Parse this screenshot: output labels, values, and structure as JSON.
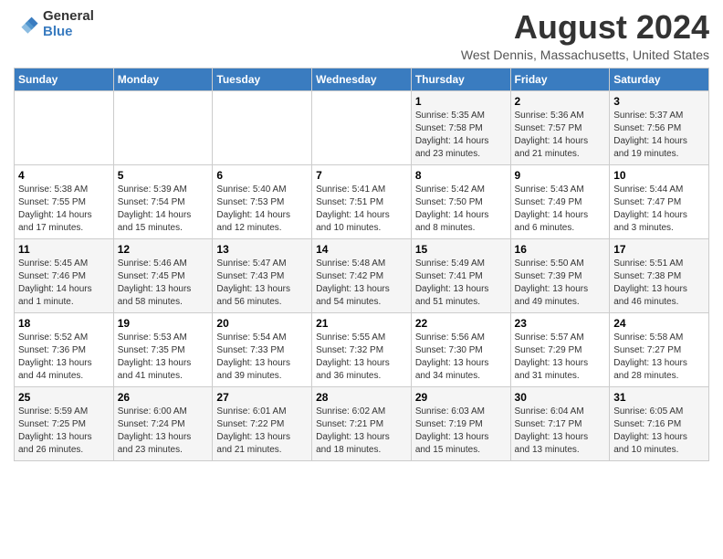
{
  "logo": {
    "general": "General",
    "blue": "Blue"
  },
  "title": "August 2024",
  "subtitle": "West Dennis, Massachusetts, United States",
  "days_of_week": [
    "Sunday",
    "Monday",
    "Tuesday",
    "Wednesday",
    "Thursday",
    "Friday",
    "Saturday"
  ],
  "weeks": [
    [
      {
        "day": "",
        "info": ""
      },
      {
        "day": "",
        "info": ""
      },
      {
        "day": "",
        "info": ""
      },
      {
        "day": "",
        "info": ""
      },
      {
        "day": "1",
        "info": "Sunrise: 5:35 AM\nSunset: 7:58 PM\nDaylight: 14 hours\nand 23 minutes."
      },
      {
        "day": "2",
        "info": "Sunrise: 5:36 AM\nSunset: 7:57 PM\nDaylight: 14 hours\nand 21 minutes."
      },
      {
        "day": "3",
        "info": "Sunrise: 5:37 AM\nSunset: 7:56 PM\nDaylight: 14 hours\nand 19 minutes."
      }
    ],
    [
      {
        "day": "4",
        "info": "Sunrise: 5:38 AM\nSunset: 7:55 PM\nDaylight: 14 hours\nand 17 minutes."
      },
      {
        "day": "5",
        "info": "Sunrise: 5:39 AM\nSunset: 7:54 PM\nDaylight: 14 hours\nand 15 minutes."
      },
      {
        "day": "6",
        "info": "Sunrise: 5:40 AM\nSunset: 7:53 PM\nDaylight: 14 hours\nand 12 minutes."
      },
      {
        "day": "7",
        "info": "Sunrise: 5:41 AM\nSunset: 7:51 PM\nDaylight: 14 hours\nand 10 minutes."
      },
      {
        "day": "8",
        "info": "Sunrise: 5:42 AM\nSunset: 7:50 PM\nDaylight: 14 hours\nand 8 minutes."
      },
      {
        "day": "9",
        "info": "Sunrise: 5:43 AM\nSunset: 7:49 PM\nDaylight: 14 hours\nand 6 minutes."
      },
      {
        "day": "10",
        "info": "Sunrise: 5:44 AM\nSunset: 7:47 PM\nDaylight: 14 hours\nand 3 minutes."
      }
    ],
    [
      {
        "day": "11",
        "info": "Sunrise: 5:45 AM\nSunset: 7:46 PM\nDaylight: 14 hours\nand 1 minute."
      },
      {
        "day": "12",
        "info": "Sunrise: 5:46 AM\nSunset: 7:45 PM\nDaylight: 13 hours\nand 58 minutes."
      },
      {
        "day": "13",
        "info": "Sunrise: 5:47 AM\nSunset: 7:43 PM\nDaylight: 13 hours\nand 56 minutes."
      },
      {
        "day": "14",
        "info": "Sunrise: 5:48 AM\nSunset: 7:42 PM\nDaylight: 13 hours\nand 54 minutes."
      },
      {
        "day": "15",
        "info": "Sunrise: 5:49 AM\nSunset: 7:41 PM\nDaylight: 13 hours\nand 51 minutes."
      },
      {
        "day": "16",
        "info": "Sunrise: 5:50 AM\nSunset: 7:39 PM\nDaylight: 13 hours\nand 49 minutes."
      },
      {
        "day": "17",
        "info": "Sunrise: 5:51 AM\nSunset: 7:38 PM\nDaylight: 13 hours\nand 46 minutes."
      }
    ],
    [
      {
        "day": "18",
        "info": "Sunrise: 5:52 AM\nSunset: 7:36 PM\nDaylight: 13 hours\nand 44 minutes."
      },
      {
        "day": "19",
        "info": "Sunrise: 5:53 AM\nSunset: 7:35 PM\nDaylight: 13 hours\nand 41 minutes."
      },
      {
        "day": "20",
        "info": "Sunrise: 5:54 AM\nSunset: 7:33 PM\nDaylight: 13 hours\nand 39 minutes."
      },
      {
        "day": "21",
        "info": "Sunrise: 5:55 AM\nSunset: 7:32 PM\nDaylight: 13 hours\nand 36 minutes."
      },
      {
        "day": "22",
        "info": "Sunrise: 5:56 AM\nSunset: 7:30 PM\nDaylight: 13 hours\nand 34 minutes."
      },
      {
        "day": "23",
        "info": "Sunrise: 5:57 AM\nSunset: 7:29 PM\nDaylight: 13 hours\nand 31 minutes."
      },
      {
        "day": "24",
        "info": "Sunrise: 5:58 AM\nSunset: 7:27 PM\nDaylight: 13 hours\nand 28 minutes."
      }
    ],
    [
      {
        "day": "25",
        "info": "Sunrise: 5:59 AM\nSunset: 7:25 PM\nDaylight: 13 hours\nand 26 minutes."
      },
      {
        "day": "26",
        "info": "Sunrise: 6:00 AM\nSunset: 7:24 PM\nDaylight: 13 hours\nand 23 minutes."
      },
      {
        "day": "27",
        "info": "Sunrise: 6:01 AM\nSunset: 7:22 PM\nDaylight: 13 hours\nand 21 minutes."
      },
      {
        "day": "28",
        "info": "Sunrise: 6:02 AM\nSunset: 7:21 PM\nDaylight: 13 hours\nand 18 minutes."
      },
      {
        "day": "29",
        "info": "Sunrise: 6:03 AM\nSunset: 7:19 PM\nDaylight: 13 hours\nand 15 minutes."
      },
      {
        "day": "30",
        "info": "Sunrise: 6:04 AM\nSunset: 7:17 PM\nDaylight: 13 hours\nand 13 minutes."
      },
      {
        "day": "31",
        "info": "Sunrise: 6:05 AM\nSunset: 7:16 PM\nDaylight: 13 hours\nand 10 minutes."
      }
    ]
  ]
}
